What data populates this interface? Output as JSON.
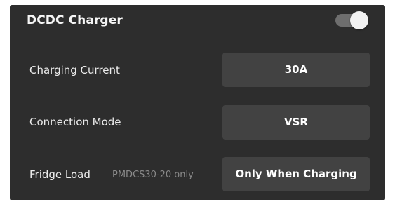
{
  "header": {
    "title": "DCDC Charger",
    "toggle_state": "on"
  },
  "settings": [
    {
      "label": "Charging Current",
      "sublabel": "",
      "value": "30A"
    },
    {
      "label": "Connection Mode",
      "sublabel": "",
      "value": "VSR"
    },
    {
      "label": "Fridge Load",
      "sublabel": "PMDCS30-20 only",
      "value": "Only When Charging"
    }
  ],
  "colors": {
    "panel_background": "#2d2d2d",
    "button_background": "#424242",
    "toggle_track": "#6e6e6e",
    "toggle_knob": "#f2f2f2",
    "sublabel_text": "#8a8a8a"
  }
}
